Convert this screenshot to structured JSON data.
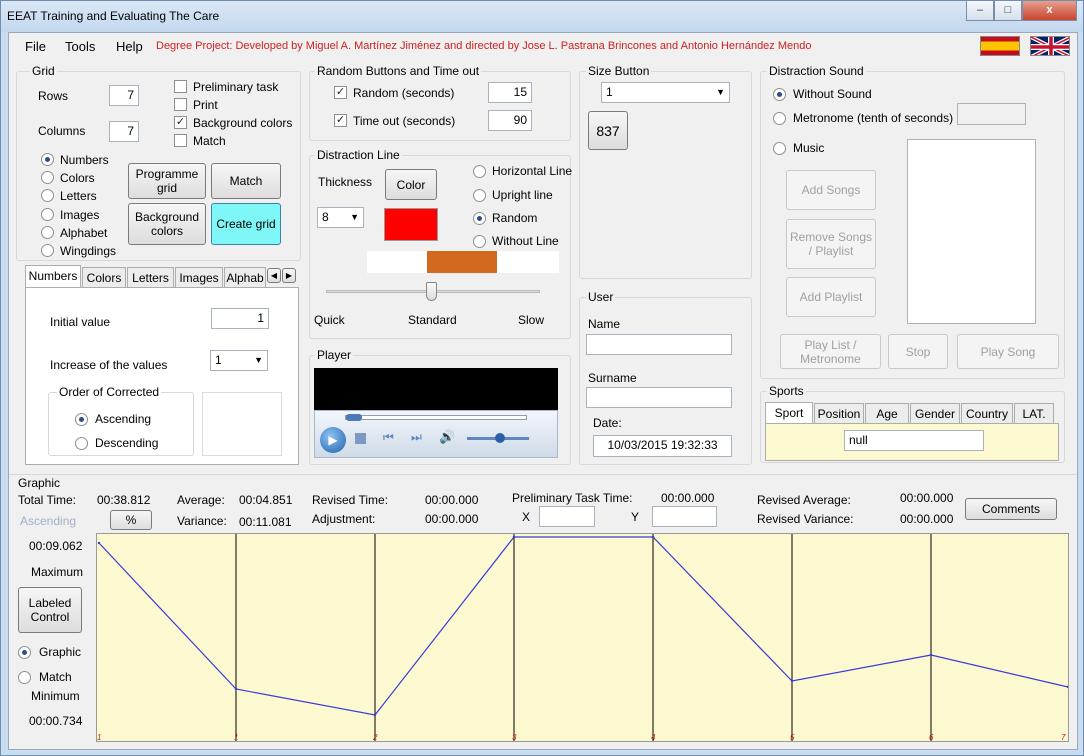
{
  "window": {
    "title": "EEAT Training and Evaluating The Care",
    "min": "–",
    "max": "□",
    "close": "x"
  },
  "menu": {
    "file": "File",
    "tools": "Tools",
    "help": "Help",
    "credits": "Degree Project: Developed by Miguel A. Martínez Jiménez and directed by Jose L. Pastrana Brincones and Antonio Hernández Mendo"
  },
  "grid": {
    "label": "Grid",
    "rows_label": "Rows",
    "rows": "7",
    "columns_label": "Columns",
    "columns": "7",
    "checks": [
      {
        "label": "Preliminary task",
        "checked": false
      },
      {
        "label": "Print",
        "checked": false
      },
      {
        "label": "Background colors",
        "checked": true
      },
      {
        "label": "Match",
        "checked": false
      }
    ],
    "radios": [
      {
        "label": "Numbers",
        "selected": true
      },
      {
        "label": "Colors",
        "selected": false
      },
      {
        "label": "Letters",
        "selected": false
      },
      {
        "label": "Images",
        "selected": false
      },
      {
        "label": "Alphabet",
        "selected": false
      },
      {
        "label": "Wingdings",
        "selected": false
      }
    ],
    "programme_grid": "Programme grid",
    "match_btn": "Match",
    "background_colors_btn": "Background colors",
    "create_grid": "Create grid",
    "create_grid_color": "#7ff7f7"
  },
  "tabs": [
    "Numbers",
    "Colors",
    "Letters",
    "Images",
    "Alphab"
  ],
  "numbers_tab": {
    "initial_label": "Initial value",
    "initial": "1",
    "increase_label": "Increase of the values",
    "increase": "1",
    "order_label": "Order of Corrected",
    "ascending": "Ascending",
    "descending": "Descending"
  },
  "random": {
    "label": "Random Buttons and Time out",
    "random_label": "Random (seconds)",
    "random_value": "15",
    "timeout_label": "Time out (seconds)",
    "timeout_value": "90"
  },
  "distraction_line": {
    "label": "Distraction Line",
    "thickness_label": "Thickness",
    "thickness": "8",
    "color_btn": "Color",
    "color_swatch": "#ff0000",
    "bar_color": "#d2691e",
    "options": [
      {
        "label": "Horizontal Line",
        "selected": false
      },
      {
        "label": "Upright line",
        "selected": false
      },
      {
        "label": "Random",
        "selected": true
      },
      {
        "label": "Without Line",
        "selected": false
      }
    ],
    "speed": {
      "quick": "Quick",
      "standard": "Standard",
      "slow": "Slow"
    }
  },
  "player": {
    "label": "Player"
  },
  "size_button": {
    "label": "Size Button",
    "value": "1",
    "preview": "837"
  },
  "user": {
    "label": "User",
    "name_label": "Name",
    "name": "",
    "surname_label": "Surname",
    "surname": "",
    "date_label": "Date:",
    "date": "10/03/2015 19:32:33"
  },
  "sound": {
    "label": "Distraction Sound",
    "without": "Without Sound",
    "metronome": "Metronome (tenth of seconds)",
    "music": "Music",
    "add_songs": "Add Songs",
    "remove": "Remove Songs / Playlist",
    "add_playlist": "Add Playlist",
    "play_list": "Play List / Metronome",
    "stop": "Stop",
    "play_song": "Play Song"
  },
  "sports": {
    "label": "Sports",
    "tabs": [
      "Sport",
      "Position",
      "Age",
      "Gender",
      "Country",
      "LAT."
    ],
    "value": "null"
  },
  "graphic": {
    "label": "Graphic",
    "total_time_label": "Total Time:",
    "total_time": "00:38.812",
    "average_label": "Average:",
    "average": "00:04.851",
    "variance_label": "Variance:",
    "variance": "00:11.081",
    "revised_time_label": "Revised Time:",
    "revised_time": "00:00.000",
    "adjustment_label": "Adjustment:",
    "adjustment": "00:00.000",
    "prelim_label": "Preliminary Task Time:",
    "prelim": "00:00.000",
    "x_label": "X",
    "y_label": "Y",
    "revised_avg_label": "Revised Average:",
    "revised_avg": "00:00.000",
    "revised_var_label": "Revised Variance:",
    "revised_var": "00:00.000",
    "comments": "Comments",
    "ascending": "Ascending",
    "percent": "%",
    "max_value": "00:09.062",
    "max_label": "Maximum",
    "min_label": "Minimum",
    "min_value": "00:00.734",
    "labeled_control": "Labeled Control",
    "graphic_radio": "Graphic",
    "match_radio": "Match"
  },
  "chart_data": {
    "type": "line",
    "x_labels": [
      "1",
      "1",
      "2",
      "3",
      "4",
      "5",
      "6",
      "7"
    ],
    "values": [
      0.97,
      0.24,
      0.11,
      1.0,
      1.0,
      0.28,
      0.41,
      0.25
    ],
    "ylim": [
      0,
      1
    ],
    "line_color": "#3a3ad6",
    "tick_label_color": "#cc2222",
    "background": "#fcf8cf"
  }
}
